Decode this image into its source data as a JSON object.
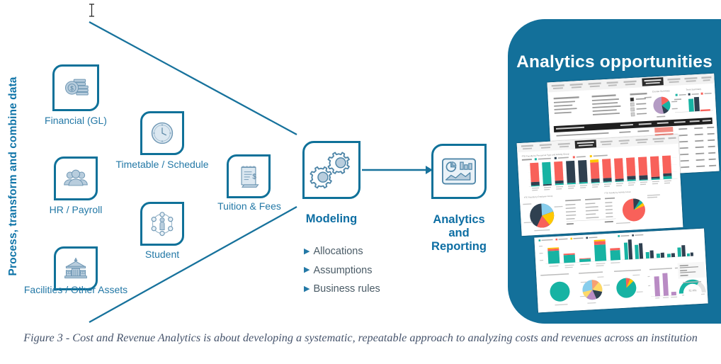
{
  "figure": {
    "vertical_label": "Process, transform and combine data",
    "caption": "Figure 3 - Cost and Revenue Analytics is about developing a systematic, repeatable approach to analyzing costs and revenues across an institution"
  },
  "colors": {
    "brand_blue": "#0f7199",
    "label_blue": "#2378a6",
    "heading_blue": "#0d6ea3",
    "panel_teal": "#13709a",
    "bullet_gray": "#4a5b66",
    "caption_gray": "#46546c",
    "icon_fill": "#b8cddd",
    "chart_red": "#f8615a",
    "chart_teal": "#17b3a3",
    "chart_dark": "#2f4050",
    "chart_yellow": "#ffc800",
    "chart_purple": "#b98bc4",
    "chart_lightblue": "#87cdec"
  },
  "sources": [
    {
      "id": "financial",
      "label": "Financial (GL)",
      "icon": "coins-icon"
    },
    {
      "id": "timetable",
      "label": "Timetable / Schedule",
      "icon": "clock-icon"
    },
    {
      "id": "hr",
      "label": "HR / Payroll",
      "icon": "people-icon"
    },
    {
      "id": "student",
      "label": "Student",
      "icon": "student-network-icon"
    },
    {
      "id": "tuition",
      "label": "Tuition  & Fees",
      "icon": "invoice-icon"
    },
    {
      "id": "facilities",
      "label": "Facilities / Other Assets",
      "icon": "building-icon"
    }
  ],
  "modeling": {
    "title": "Modeling",
    "icon": "gears-icon",
    "bullets": [
      "Allocations",
      "Assumptions",
      "Business rules"
    ],
    "bullet_marker": "▶"
  },
  "reporting": {
    "title_lines": [
      "Analytics",
      "and",
      "Reporting"
    ],
    "icon": "report-chart-icon"
  },
  "panel": {
    "title": "Analytics opportunities"
  },
  "chart_data": [
    {
      "id": "dashboard-top",
      "type": "table",
      "title": "Course detail dashboard",
      "tabs": [
        "Administrative Services",
        "College of Arts & Sciences",
        "College of Computer Sci.",
        "Law School",
        "School of Art & Design",
        "School of Arts & Media Science",
        "School of Health Professions",
        "School of Art Arts & Literature",
        "School of Management",
        "Undecided"
      ],
      "selected_tab": "School of Arts & Media Science",
      "filters": [
        "Course Campus Major Group",
        "Course Department",
        "Course Level"
      ],
      "pie_title": "Course Summary",
      "bar_title": "Term Summary",
      "legend": [
        "Actual",
        "Net Revenue",
        "Net Margin"
      ],
      "row_count": 7,
      "highlight_colors": [
        "#f28b82",
        "#9fd8ef"
      ]
    },
    {
      "id": "dashboard-middle",
      "type": "bar",
      "title": "FTE Faculty by Personnel Type and Activity Group",
      "stacked": true,
      "categories": [
        "Computer Science",
        "Dean of College",
        "Electrical Engineering",
        "Engineering Technology",
        "Engineering Technology Institute",
        "Industrial Design",
        "Interior Design",
        "Materials Science Engineering",
        "Mechanical Engineering",
        "Mechanical Engineering Tech",
        "Structural Engineering",
        "Data Science and Machine Learning"
      ],
      "series": [
        {
          "name": "Research and Outreach",
          "color": "#17b3a3",
          "values": [
            12,
            72,
            10,
            2,
            2,
            10,
            8,
            6,
            5,
            6,
            4,
            6
          ]
        },
        {
          "name": "FTE Faculty Research",
          "color": "#2f4050",
          "values": [
            16,
            2,
            12,
            70,
            70,
            8,
            12,
            4,
            14,
            16,
            4,
            8
          ]
        },
        {
          "name": "FTE Teaching",
          "color": "#f8615a",
          "values": [
            62,
            2,
            62,
            2,
            2,
            66,
            64,
            70,
            65,
            62,
            68,
            60
          ]
        },
        {
          "name": "Profit Contribution Service",
          "color": "#ffc800",
          "values": [
            2,
            2,
            2,
            2,
            2,
            10,
            2,
            2,
            2,
            2,
            2,
            2
          ]
        }
      ],
      "sub_charts": [
        {
          "type": "pie",
          "title": "FTE Faculty by Employee Group",
          "labels": [
            "Professor",
            "Adjunct",
            "Assistant Professor",
            "Associate Professor",
            "Professional Staff"
          ],
          "values": [
            38,
            14,
            18,
            16,
            14
          ],
          "colors": [
            "#2f4050",
            "#f8615a",
            "#ffc800",
            "#87cdec",
            "#17b3a3"
          ]
        },
        {
          "type": "table",
          "title": "Personnel detail",
          "columns": [
            "Personnel Type",
            "Employee Group",
            "FTE Faculty",
            "FTE Staff"
          ],
          "rows": [
            [
              "Faculty",
              "Adjunct",
              "12.46",
              "0.00"
            ],
            [
              "Faculty",
              "Assistant Professor",
              "11.99",
              "0.00"
            ],
            [
              "Faculty",
              "Associate Professor",
              "17.50",
              "0.00"
            ],
            [
              "Faculty",
              "Professor",
              "12.89",
              "0.00"
            ],
            [
              "Staff",
              "Professional Staff",
              "0.00",
              "18.75"
            ],
            [
              "Total",
              "",
              "55.13",
              "18.75"
            ]
          ]
        },
        {
          "type": "pie",
          "title": "FTE Faculty by Activity Group",
          "labels": [
            "Research and Outreach",
            "Research",
            "Teaching"
          ],
          "values": [
            8,
            6,
            86
          ],
          "colors": [
            "#2f4050",
            "#17b3a3",
            "#f8615a"
          ]
        }
      ]
    },
    {
      "id": "dashboard-bottom",
      "type": "bar",
      "title": "Revenue and margin dashboard",
      "categories": [
        "Nurse Provider",
        "College of Computer Sci.",
        "School of Art & Design",
        "School of Health Professions",
        "School of Nursing"
      ],
      "series": [
        {
          "name": "Net Revenue",
          "color": "#17b3a3",
          "values": [
            52,
            30,
            6,
            80,
            40
          ]
        },
        {
          "name": "Net Margin",
          "color": "#f8615a",
          "values": [
            8,
            4,
            2,
            10,
            6
          ]
        },
        {
          "name": "Other",
          "color": "#ffc800",
          "values": [
            3,
            2,
            1,
            4,
            2
          ]
        }
      ],
      "sub_charts": [
        {
          "type": "bar",
          "title": "Margin by Department",
          "series": [
            {
              "name": "Teal",
              "color": "#17b3a3",
              "values": [
                56,
                45,
                20,
                12,
                8,
                7,
                30,
                6,
                9
              ]
            },
            {
              "name": "Dark",
              "color": "#2f4050",
              "values": [
                68,
                38,
                22,
                14,
                10,
                8,
                36,
                7,
                10
              ]
            }
          ]
        },
        {
          "type": "pie",
          "title": "Cost Distribution by Course Campus Major Group",
          "labels": [
            "Consolidated"
          ],
          "values": [
            100
          ],
          "colors": [
            "#17b3a3"
          ]
        },
        {
          "type": "pie",
          "title": "Cost Distribution by Course Level",
          "labels": [
            "100 Level",
            "200 Level",
            "300 Level",
            "400 Level",
            "500 Level",
            "600 Level",
            "700 Level"
          ],
          "values": [
            18,
            16,
            14,
            16,
            12,
            12,
            12
          ],
          "colors": [
            "#f7a072",
            "#2f4050",
            "#b98bc4",
            "#ffd966",
            "#87cdec",
            "#17b3a3",
            "#f8615a"
          ]
        },
        {
          "type": "pie",
          "title": "Cost Distribution by Primary Employee Level",
          "labels": [
            "Adjunct",
            "Faculty",
            "Other"
          ],
          "values": [
            78,
            14,
            8
          ],
          "colors": [
            "#17b3a3",
            "#ffc800",
            "#f8615a"
          ]
        },
        {
          "type": "bar",
          "title": "Course Count Subject Contribution",
          "categories": [
            "100",
            "Spring",
            "Consolidated"
          ],
          "values": [
            74,
            86,
            14
          ],
          "color": "#b98bc4"
        },
        {
          "type": "gauge",
          "title": "Margin Percent Contribution",
          "value": 72,
          "value_label": "72.4%",
          "min": 0,
          "max": 100,
          "color": "#17b3a3"
        }
      ]
    }
  ]
}
